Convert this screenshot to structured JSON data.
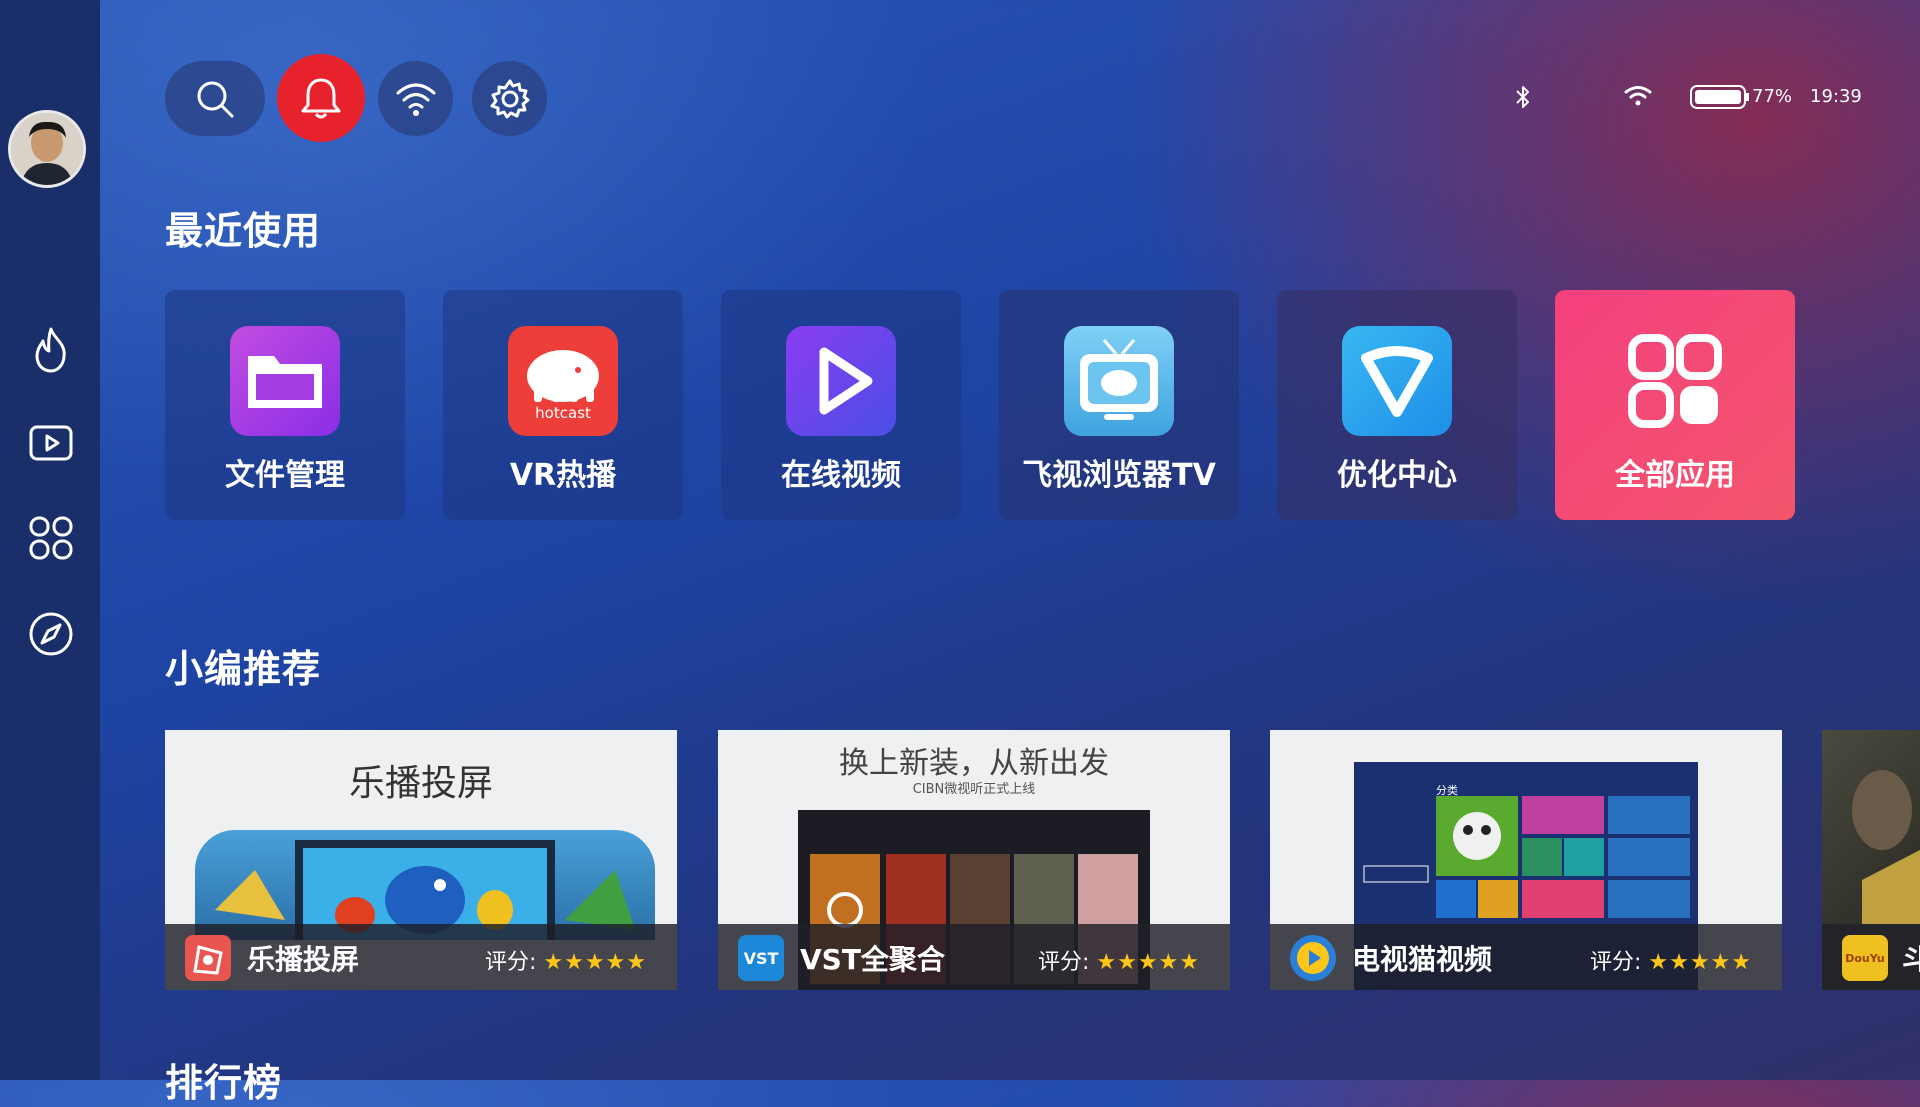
{
  "topbar": {
    "search_icon": "search-icon",
    "bell_icon": "bell-icon",
    "wifi_icon": "wifi-icon",
    "gear_icon": "gear-icon"
  },
  "status": {
    "bluetooth_icon": "bluetooth-icon",
    "wifi_icon": "wifi-icon",
    "battery_percent": "77%",
    "time": "19:39"
  },
  "sidebar": {
    "items": [
      {
        "icon": "flame-icon"
      },
      {
        "icon": "play-icon"
      },
      {
        "icon": "apps-icon"
      },
      {
        "icon": "compass-icon"
      }
    ]
  },
  "recent": {
    "title": "最近使用",
    "apps": [
      {
        "label": "文件管理",
        "icon": "folder-icon"
      },
      {
        "label": "VR热播",
        "icon": "hotcast-icon",
        "icon_text": "hotcast"
      },
      {
        "label": "在线视频",
        "icon": "play-icon"
      },
      {
        "label": "飞视浏览器TV",
        "icon": "tv-globe-icon"
      },
      {
        "label": "优化中心",
        "icon": "shield-icon"
      },
      {
        "label": "全部应用",
        "icon": "apps-icon"
      }
    ]
  },
  "featured": {
    "title": "小编推荐",
    "cards": [
      {
        "banner": "乐播投屏",
        "name": "乐播投屏",
        "rating_label": "评分:",
        "stars": "★★★★★"
      },
      {
        "banner": "换上新装，从新出发",
        "banner_sub": "CIBN微视听正式上线",
        "name": "VST全聚合",
        "rating_label": "评分:",
        "stars": "★★★★★",
        "icon_text": "VST"
      },
      {
        "banner": "分类",
        "name": "电视猫视频",
        "rating_label": "评分:",
        "stars": "★★★★★"
      },
      {
        "name": "斗",
        "icon_text": "DouYu"
      }
    ]
  },
  "ranking": {
    "title": "排行榜"
  },
  "colors": {
    "bell_active": "#e7222d",
    "all_apps_tile": "#f5407e",
    "star": "#ffc61a"
  }
}
